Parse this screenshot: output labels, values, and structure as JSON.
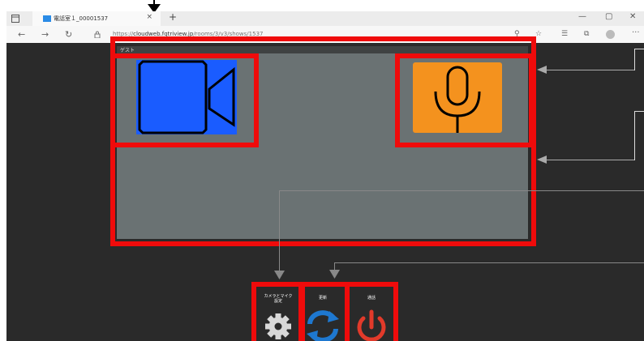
{
  "browser": {
    "tab_title": "電話室１_00001537",
    "tab_close": "×",
    "new_tab": "+",
    "url_prefix": "https://",
    "url_host": "cloudweb.fqtriview.jp",
    "url_path": "/rooms/3/v3/shows/1537",
    "win_minimize": "—",
    "win_maximize": "▢",
    "win_close": "✕",
    "back": "←",
    "forward": "→",
    "reload": "↻",
    "more": "···"
  },
  "panel": {
    "guest_label": "ゲスト"
  },
  "controls": {
    "camera_mic": "カメラとマイク\n設定",
    "switch": "更新",
    "end_call": "通話"
  },
  "colors": {
    "highlight": "#ef0b0b",
    "camera": "#1a5cff",
    "mic": "#f4921e",
    "gear": "#d8d8d8",
    "refresh": "#1e78d0",
    "power": "#e23a2a"
  }
}
